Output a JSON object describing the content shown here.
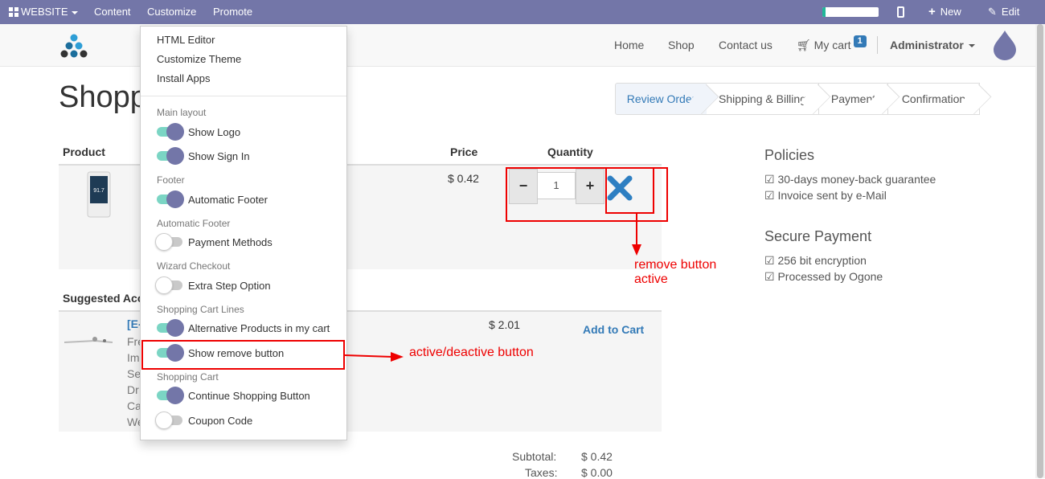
{
  "topbar": {
    "website_label": "WEBSITE",
    "menu": [
      "Content",
      "Customize",
      "Promote"
    ],
    "progress_percent": 5,
    "new_label": "New",
    "edit_label": "Edit",
    "bg_color": "#7376a8"
  },
  "nav": {
    "links": [
      "Home",
      "Shop",
      "Contact us"
    ],
    "cart_label": "My cart",
    "cart_count": "1",
    "user": "Administrator"
  },
  "page": {
    "title": "Shopping Cart"
  },
  "wizard": [
    "Review Order",
    "Shipping & Billing",
    "Payment",
    "Confirmation"
  ],
  "cart": {
    "headers": {
      "product": "Product",
      "price": "Price",
      "quantity": "Quantity"
    },
    "line": {
      "price": "$ 0.42",
      "qty": "1",
      "minus": "−",
      "plus": "+"
    },
    "suggested_title": "Suggested Accessories",
    "suggested": {
      "name": "[E-COM]",
      "desc": [
        "Fre",
        "Im",
        "Se",
        "Dr",
        "Ca",
        "We"
      ],
      "price": "$ 2.01",
      "add_label": "Add to Cart"
    },
    "subtotal_label": "Subtotal:",
    "subtotal_value": "$ 0.42",
    "taxes_label": "Taxes:",
    "taxes_value": "$ 0.00"
  },
  "policies": {
    "title": "Policies",
    "items": [
      "☑ 30-days money-back guarantee",
      "☑ Invoice sent by e-Mail"
    ],
    "secure_title": "Secure Payment",
    "secure_items": [
      "☑ 256 bit encryption",
      "☑ Processed by Ogone"
    ]
  },
  "customize_menu": {
    "items": [
      "HTML Editor",
      "Customize Theme",
      "Install Apps"
    ],
    "sections": [
      {
        "header": "Main layout",
        "toggles": [
          {
            "label": "Show Logo",
            "on": true
          },
          {
            "label": "Show Sign In",
            "on": true
          }
        ]
      },
      {
        "header": "Footer",
        "toggles": [
          {
            "label": "Automatic Footer",
            "on": true
          }
        ]
      },
      {
        "header": "Automatic Footer",
        "toggles": [
          {
            "label": "Payment Methods",
            "on": false
          }
        ]
      },
      {
        "header": "Wizard Checkout",
        "toggles": [
          {
            "label": "Extra Step Option",
            "on": false
          }
        ]
      },
      {
        "header": "Shopping Cart Lines",
        "toggles": [
          {
            "label": "Alternative Products in my cart",
            "on": true
          },
          {
            "label": "Show remove button",
            "on": true
          }
        ]
      },
      {
        "header": "Shopping Cart",
        "toggles": [
          {
            "label": "Continue Shopping Button",
            "on": true
          },
          {
            "label": "Coupon Code",
            "on": false
          }
        ]
      }
    ]
  },
  "annotations": {
    "remove_line1": "remove button",
    "remove_line2": "active",
    "toggle_note": "active/deactive button",
    "color": "#e00000"
  }
}
